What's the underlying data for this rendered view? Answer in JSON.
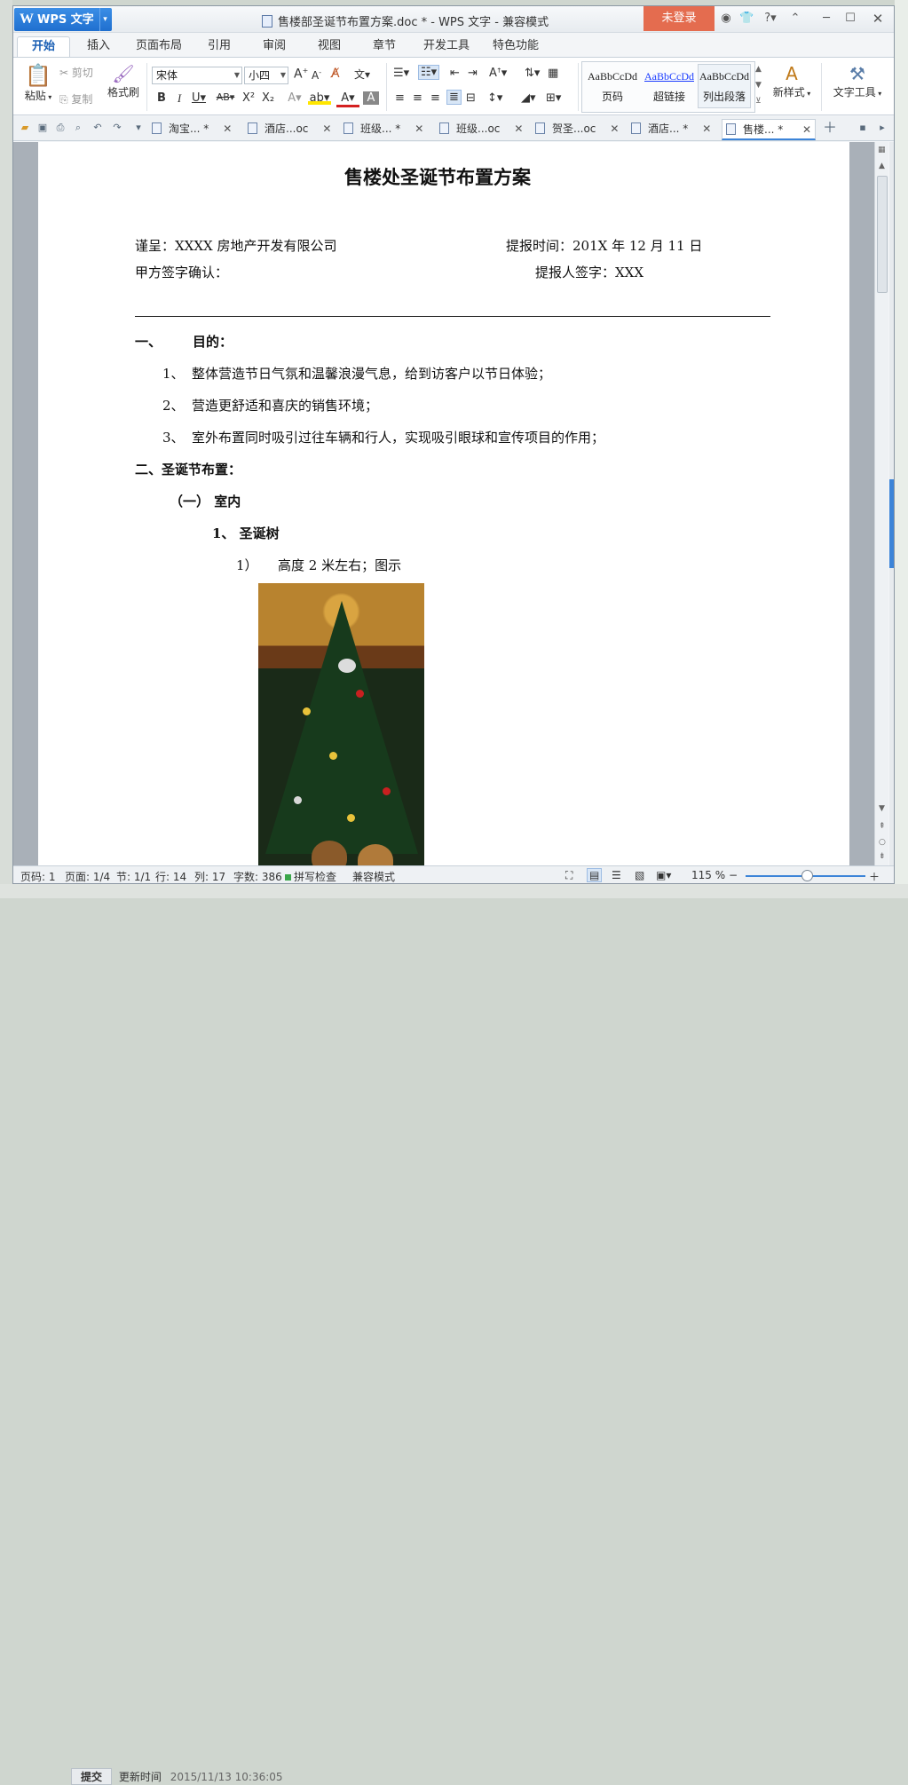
{
  "app": {
    "name": "WPS 文字",
    "window_title": "售楼部圣诞节布置方案.doc * - WPS 文字 - 兼容模式",
    "login_label": "未登录"
  },
  "ribbon_tabs": [
    "开始",
    "插入",
    "页面布局",
    "引用",
    "审阅",
    "视图",
    "章节",
    "开发工具",
    "特色功能"
  ],
  "ribbon": {
    "paste": "粘贴",
    "cut": "剪切",
    "copy": "复制",
    "format_painter": "格式刷",
    "font_name": "宋体",
    "font_size": "小四",
    "styles": [
      {
        "preview": "AaBbCcDd",
        "name": "页码"
      },
      {
        "preview": "AaBbCcDd",
        "name": "超链接"
      },
      {
        "preview": "AaBbCcDd",
        "name": "列出段落"
      }
    ],
    "new_style": "新样式",
    "text_tools": "文字工具"
  },
  "doc_tabs": [
    {
      "label": "淘宝... *"
    },
    {
      "label": "酒店...oc"
    },
    {
      "label": "班级... *"
    },
    {
      "label": "班级...oc"
    },
    {
      "label": "贺圣...oc"
    },
    {
      "label": "酒店... *"
    },
    {
      "label": "售楼... *"
    }
  ],
  "document": {
    "title": "售楼处圣诞节布置方案",
    "to_line": "谨呈：XXXX 房地产开发有限公司",
    "date_line": "提报时间：201X 年 12 月 11 日",
    "sign_line": "甲方签字确认：",
    "submitter_line": "提报人签字：XXX",
    "s1_num": "一、",
    "s1_head": "目的：",
    "items": [
      {
        "num": "1、",
        "text": "整体营造节日气氛和温馨浪漫气息，给到访客户以节日体验；"
      },
      {
        "num": "2、",
        "text": "营造更舒适和喜庆的销售环境；"
      },
      {
        "num": "3、",
        "text": "室外布置同时吸引过往车辆和行人，实现吸引眼球和宣传项目的作用；"
      }
    ],
    "s2_head": "二、圣诞节布置：",
    "sub1": "（一）  室内",
    "sub1_1": "1、   圣诞树",
    "sub1_1_1_num": "1）",
    "sub1_1_1": "高度 2 米左右；图示"
  },
  "status": {
    "page": "页码: 1",
    "pages": "页面: 1/4",
    "section": "节: 1/1",
    "row": "行: 14",
    "col": "列: 17",
    "words": "字数: 386",
    "spell": "拼写检查",
    "mode": "兼容模式",
    "zoom": "115 %"
  },
  "bottom": {
    "submit": "提交",
    "update": "更新时间",
    "time": "2015/11/13 10:36:05"
  }
}
